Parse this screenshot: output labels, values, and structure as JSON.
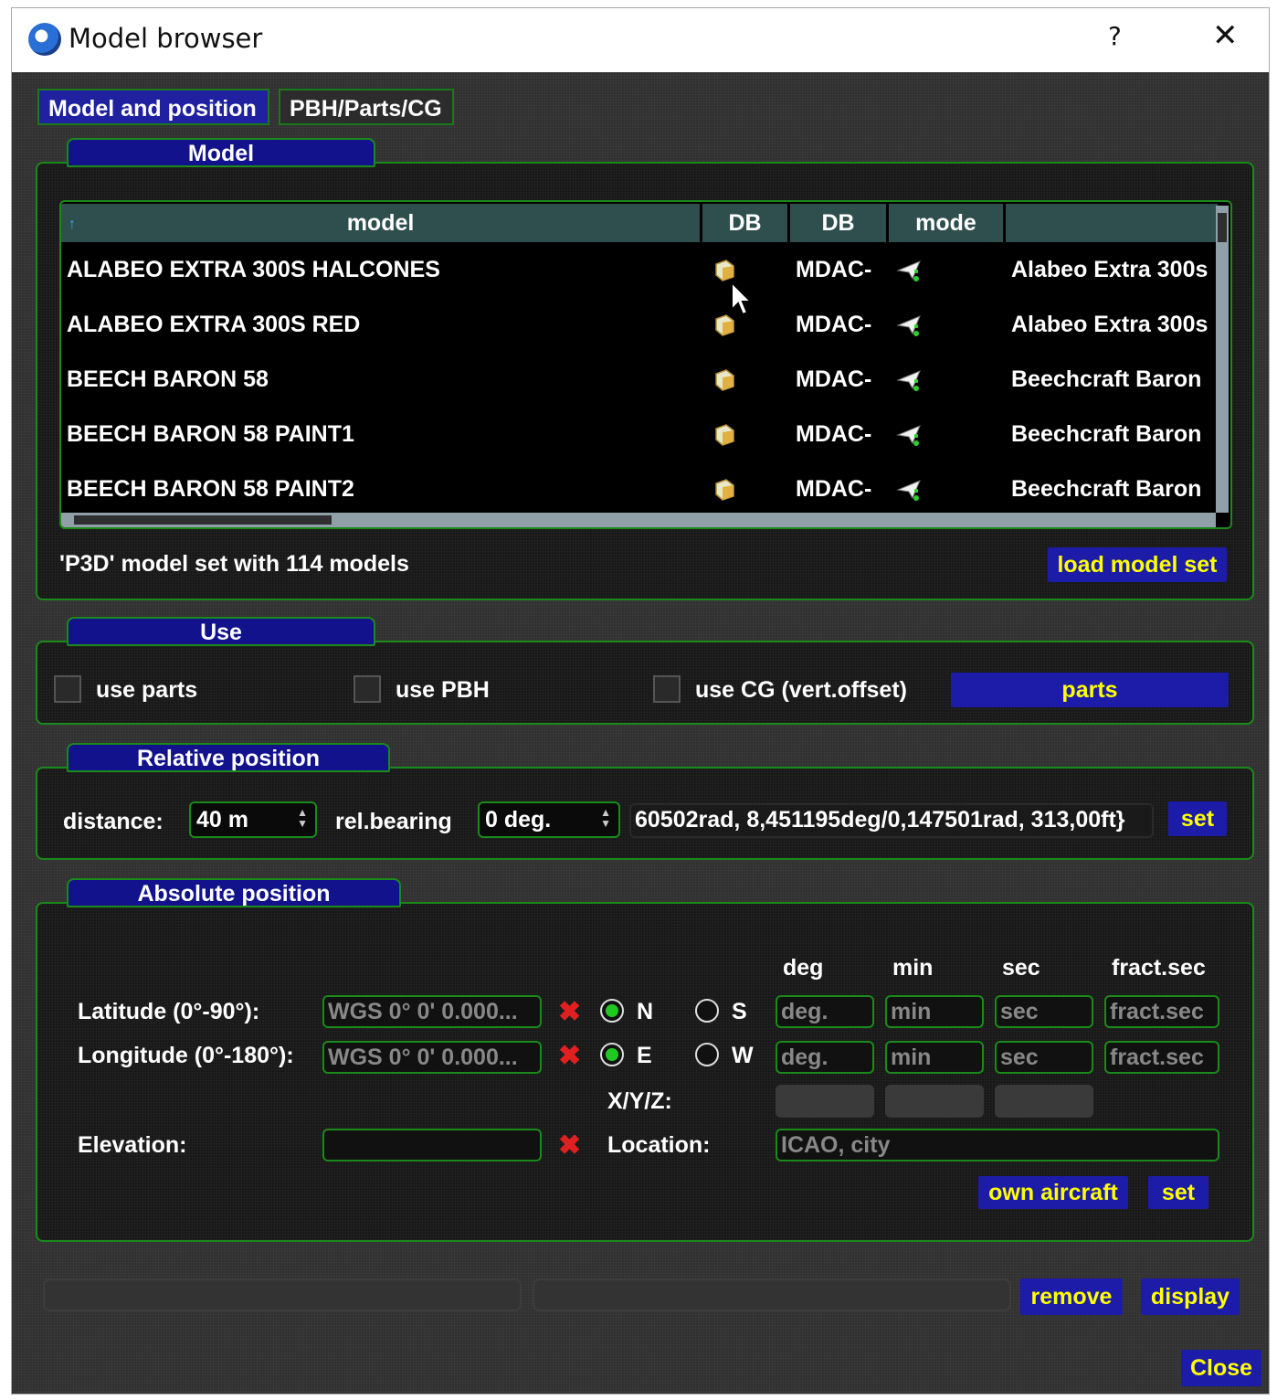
{
  "window": {
    "title": "Model browser",
    "help": "?",
    "close": "✕"
  },
  "tabs": [
    {
      "label": "Model and position"
    },
    {
      "label": "PBH/Parts/CG"
    }
  ],
  "model_panel": {
    "title": "Model",
    "columns": [
      "model",
      "DB",
      "DB",
      "mode",
      ""
    ],
    "rows": [
      {
        "model": "ALABEO EXTRA 300S HALCONES",
        "db": "MDAC-",
        "desc": "Alabeo Extra 300s"
      },
      {
        "model": "ALABEO EXTRA 300S RED",
        "db": "MDAC-",
        "desc": "Alabeo Extra 300s"
      },
      {
        "model": "BEECH BARON 58",
        "db": "MDAC-",
        "desc": "Beechcraft Baron"
      },
      {
        "model": "BEECH BARON 58 PAINT1",
        "db": "MDAC-",
        "desc": "Beechcraft Baron"
      },
      {
        "model": "BEECH BARON 58 PAINT2",
        "db": "MDAC-",
        "desc": "Beechcraft Baron"
      }
    ],
    "status": "'P3D' model set with 114 models",
    "load_button": "load model set"
  },
  "use_panel": {
    "title": "Use",
    "use_parts": "use parts",
    "use_pbh": "use PBH",
    "use_cg": "use CG (vert.offset)",
    "parts_button": "parts"
  },
  "relative_panel": {
    "title": "Relative position",
    "distance_label": "distance:",
    "distance_value": "40 m",
    "bearing_label": "rel.bearing",
    "bearing_value": "0 deg.",
    "coords": "60502rad, 8,451195deg/0,147501rad, 313,00ft}",
    "set_button": "set"
  },
  "absolute_panel": {
    "title": "Absolute position",
    "col_headers": [
      "deg",
      "min",
      "sec",
      "fract.sec"
    ],
    "lat_label": "Latitude (0°-90°):",
    "lon_label": "Longitude (0°-180°):",
    "wgs_placeholder": "WGS 0° 0' 0.000...",
    "n": "N",
    "s": "S",
    "e": "E",
    "w": "W",
    "ph_deg": "deg.",
    "ph_min": "min",
    "ph_sec": "sec",
    "ph_fract": "fract.sec",
    "xyz_label": "X/Y/Z:",
    "elevation_label": "Elevation:",
    "location_label": "Location:",
    "location_placeholder": "ICAO, city",
    "own_aircraft_button": "own aircraft",
    "set_button": "set"
  },
  "bottom": {
    "remove_button": "remove",
    "display_button": "display",
    "close_button": "Close"
  },
  "colors": {
    "panel_border": "#1a8a1a",
    "button_bg": "#1c1ca8",
    "button_text": "#ffff00",
    "header_bg": "#2f4f4f"
  }
}
